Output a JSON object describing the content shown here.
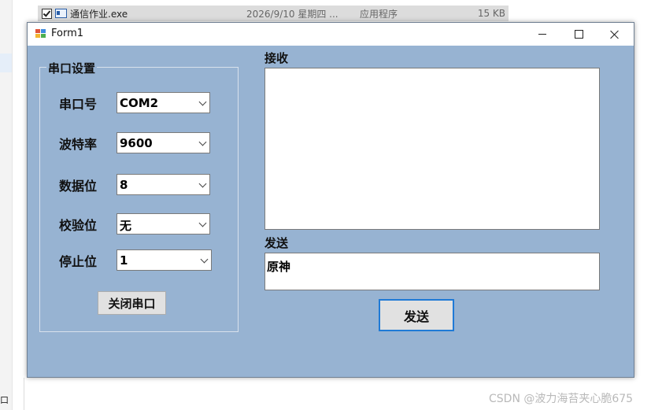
{
  "explorer": {
    "file_name": "通信作业.exe",
    "file_date": "2026/9/10 星期四 ...",
    "file_type": "应用程序",
    "file_size": "15 KB",
    "left_glyph": "口"
  },
  "window": {
    "title": "Form1"
  },
  "serial_settings": {
    "group_title": "串口设置",
    "port_label": "串口号",
    "port_value": "COM2",
    "baud_label": "波特率",
    "baud_value": "9600",
    "databits_label": "数据位",
    "databits_value": "8",
    "parity_label": "校验位",
    "parity_value": "无",
    "stopbits_label": "停止位",
    "stopbits_value": "1",
    "close_button": "关闭串口"
  },
  "receive": {
    "label": "接收",
    "content": ""
  },
  "send": {
    "label": "发送",
    "content": "原神",
    "button": "发送"
  },
  "watermark": "CSDN @波力海苔夹心脆675"
}
